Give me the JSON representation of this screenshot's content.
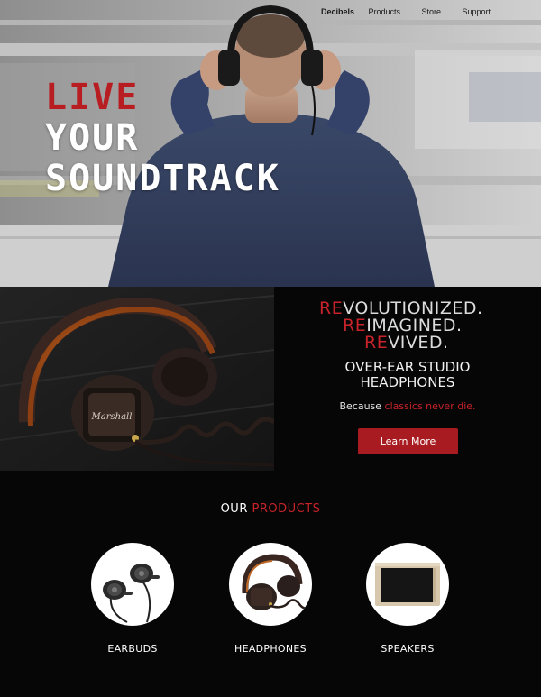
{
  "nav": {
    "brand": "Decibels",
    "items": [
      "Products",
      "Store",
      "Support"
    ]
  },
  "hero": {
    "line1": "LIVE",
    "line2": "YOUR",
    "line3": "SOUNDTRACK"
  },
  "feature": {
    "taglines": [
      {
        "prefix": "RE",
        "rest": "VOLUTIONIZED."
      },
      {
        "prefix": "RE",
        "rest": "IMAGINED."
      },
      {
        "prefix": "RE",
        "rest": "VIVED."
      }
    ],
    "product_line1": "OVER-EAR STUDIO",
    "product_line2": "HEADPHONES",
    "slogan_prefix": "Because ",
    "slogan_highlight": "classics never die.",
    "button_label": "Learn More",
    "headphone_brand": "Marshall"
  },
  "products": {
    "title_prefix": "OUR ",
    "title_highlight": "PRODUCTS",
    "items": [
      {
        "label": "EARBUDS"
      },
      {
        "label": "HEADPHONES"
      },
      {
        "label": "SPEAKERS"
      }
    ]
  },
  "colors": {
    "accent_red": "#c8232a",
    "button_red": "#a81c21",
    "background": "#060606"
  }
}
